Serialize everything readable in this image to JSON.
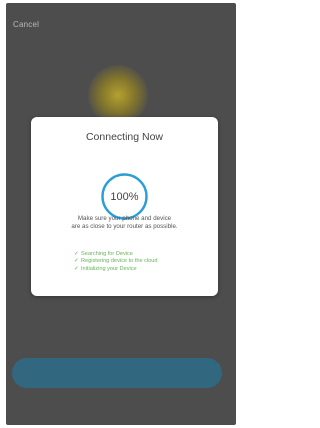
{
  "header": {
    "cancel_label": "Cancel"
  },
  "dialog": {
    "title": "Connecting Now",
    "progress_text": "100%",
    "progress": 1.0,
    "message_line1": "Make sure your phone and device",
    "message_line2": "are as close to your router as possible.",
    "steps": [
      {
        "check": "✓",
        "label": "Searching for Device"
      },
      {
        "check": "✓",
        "label": "Registering device to the cloud"
      },
      {
        "check": "✓",
        "label": "Initializing your Device"
      }
    ]
  },
  "colors": {
    "accent": "#2a9fd6",
    "success": "#66b45a",
    "overlay": "#4d4d4d"
  }
}
